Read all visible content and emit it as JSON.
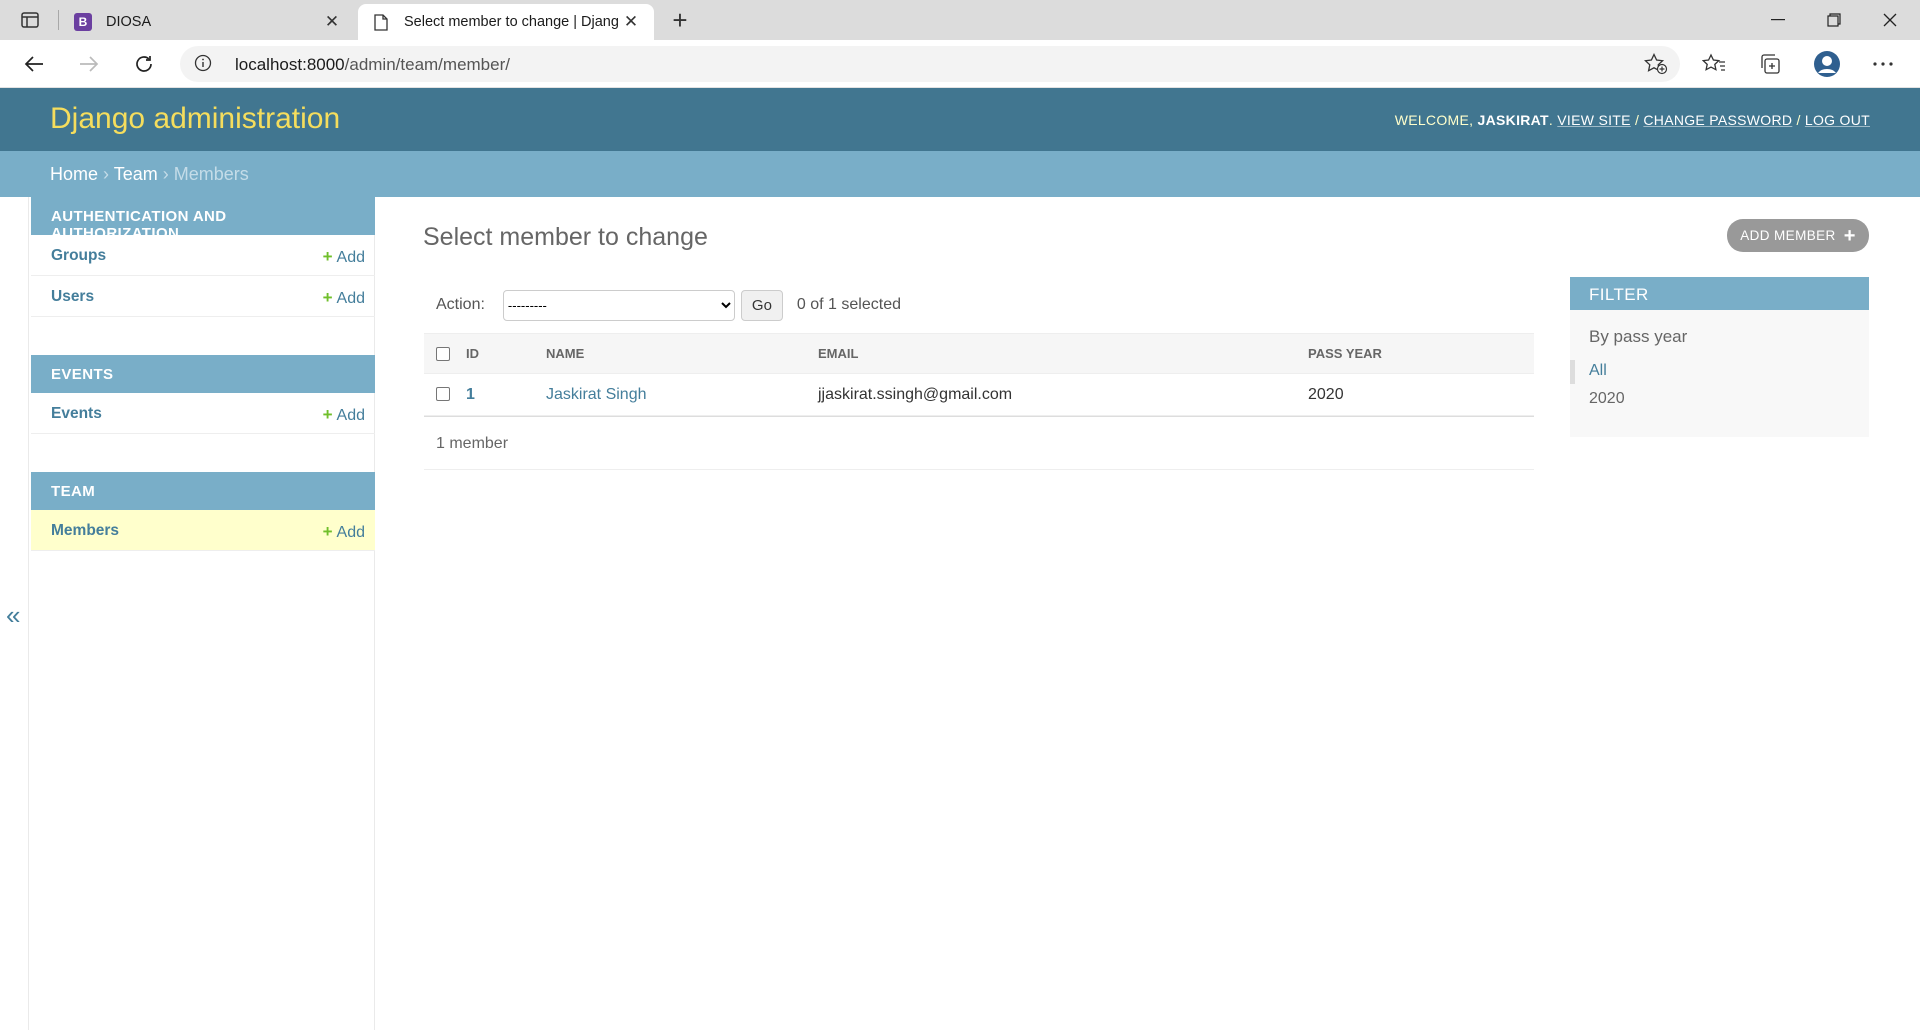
{
  "browser": {
    "tabs": [
      {
        "title": "DIOSA",
        "favicon": "B",
        "active": false
      },
      {
        "title": "Select member to change | Djang",
        "active": true
      }
    ],
    "url_host": "localhost:8000",
    "url_path": "/admin/team/member/"
  },
  "header": {
    "brand": "Django administration",
    "welcome": "WELCOME,",
    "username": "JASKIRAT",
    "view_site": "VIEW SITE",
    "change_password": "CHANGE PASSWORD",
    "log_out": "LOG OUT"
  },
  "breadcrumbs": {
    "home": "Home",
    "app": "Team",
    "current": "Members"
  },
  "sidebar": {
    "modules": [
      {
        "caption": "AUTHENTICATION AND AUTHORIZATION",
        "models": [
          {
            "name": "Groups",
            "add": "Add"
          },
          {
            "name": "Users",
            "add": "Add"
          }
        ]
      },
      {
        "caption": "EVENTS",
        "models": [
          {
            "name": "Events",
            "add": "Add"
          }
        ]
      },
      {
        "caption": "TEAM",
        "models": [
          {
            "name": "Members",
            "add": "Add"
          }
        ]
      }
    ],
    "toggle": "«"
  },
  "main": {
    "title": "Select member to change",
    "add_button": "ADD MEMBER",
    "action_label": "Action:",
    "action_value": "---------",
    "go": "Go",
    "selected_count": "0 of 1 selected",
    "columns": [
      "ID",
      "NAME",
      "EMAIL",
      "PASS YEAR"
    ],
    "rows": [
      {
        "id": "1",
        "name": "Jaskirat Singh",
        "email": "jjaskirat.ssingh@gmail.com",
        "pass_year": "2020"
      }
    ],
    "paginator": "1 member"
  },
  "filter": {
    "caption": "FILTER",
    "by": "By pass year",
    "options": [
      "All",
      "2020"
    ]
  },
  "colors": {
    "header": "#417690",
    "accent": "#79aec8",
    "brand": "#f5dd5d",
    "link": "#447e9b"
  }
}
